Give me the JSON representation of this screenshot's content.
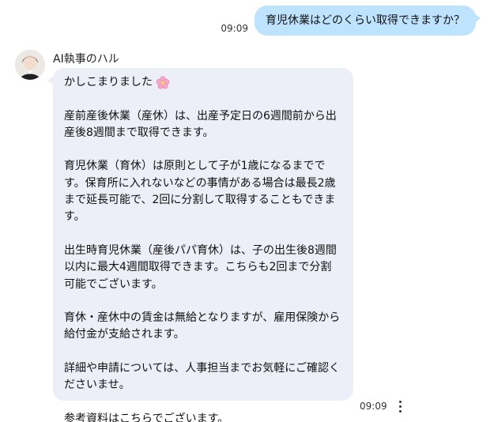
{
  "user_message": {
    "text": "育児休業はどのくらい取得できますか？",
    "time": "09:09"
  },
  "bot": {
    "name": "AI執事のハル",
    "time": "09:09",
    "greeting": "かしこまりました",
    "greeting_icon": "cherry-blossom-icon",
    "paragraphs": [
      "産前産後休業（産休）は、出産予定日の6週間前から出産後8週間まで取得できます。",
      "育児休業（育休）は原則として子が1歳になるまでです。保育所に入れないなどの事情がある場合は最長2歳まで延長可能で、2回に分割して取得することもできます。",
      "出生時育児休業（産後パパ育休）は、子の出生後8週間以内に最大4週間取得できます。こちらも2回まで分割可能でございます。",
      "育休・産休中の賃金は無給となりますが、雇用保険から給付金が支給されます。",
      "詳細や申請については、人事担当までお気軽にご確認くださいませ。",
      "参考資料はこちらでございます。"
    ]
  },
  "colors": {
    "user_bubble": "#bde3ff",
    "bot_bubble": "#eceef8"
  },
  "icons": {
    "more": "more-vertical-icon",
    "avatar": "avatar"
  }
}
